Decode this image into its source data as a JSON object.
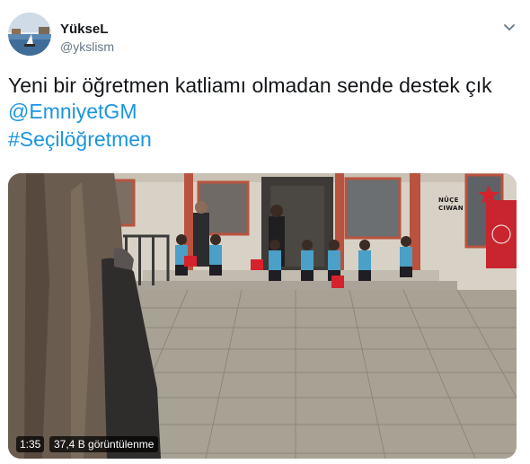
{
  "author": {
    "name": "YükseL",
    "handle": "@ykslism"
  },
  "tweet": {
    "text": "Yeni bir öğretmen katliamı olmadan sende destek çık",
    "mention": "@EmniyetGM",
    "hashtag": "#Seçilöğretmen"
  },
  "video": {
    "duration": "1:35",
    "views": "37,4 B görüntülenme",
    "watermark_line1": "NÛÇE",
    "watermark_line2": "CIWAN"
  },
  "icons": {
    "caret": "chevron-down-icon"
  },
  "colors": {
    "link": "#1b95e0",
    "secondary_text": "#657786",
    "flag_red": "#d6222c"
  }
}
